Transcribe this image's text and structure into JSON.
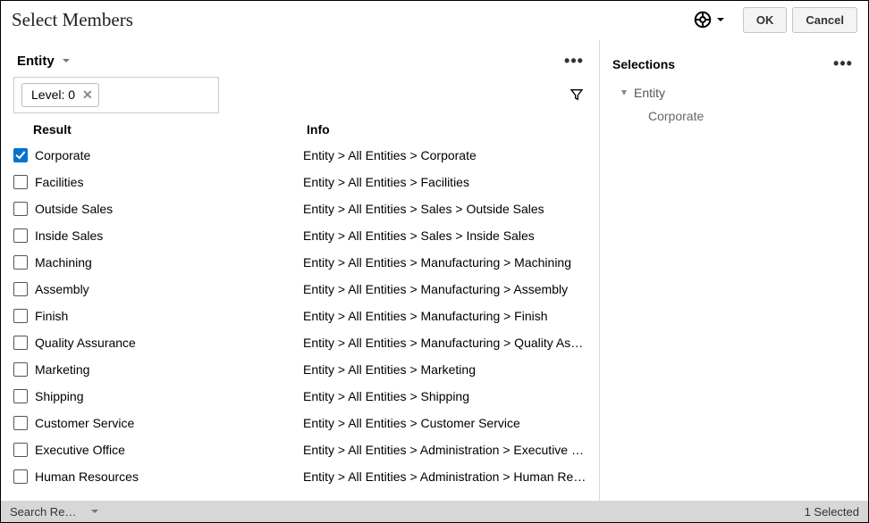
{
  "title": "Select Members",
  "buttons": {
    "ok": "OK",
    "cancel": "Cancel"
  },
  "dimension": {
    "name": "Entity"
  },
  "filter_chip": {
    "label": "Level: 0"
  },
  "columns": {
    "result": "Result",
    "info": "Info"
  },
  "rows": [
    {
      "name": "Corporate",
      "info": "Entity > All Entities > Corporate",
      "checked": true
    },
    {
      "name": "Facilities",
      "info": "Entity > All Entities > Facilities",
      "checked": false
    },
    {
      "name": "Outside Sales",
      "info": "Entity > All Entities > Sales > Outside Sales",
      "checked": false
    },
    {
      "name": "Inside Sales",
      "info": "Entity > All Entities > Sales > Inside Sales",
      "checked": false
    },
    {
      "name": "Machining",
      "info": "Entity > All Entities > Manufacturing > Machining",
      "checked": false
    },
    {
      "name": "Assembly",
      "info": "Entity > All Entities > Manufacturing > Assembly",
      "checked": false
    },
    {
      "name": "Finish",
      "info": "Entity > All Entities > Manufacturing > Finish",
      "checked": false
    },
    {
      "name": "Quality Assurance",
      "info": "Entity > All Entities > Manufacturing > Quality Ass…",
      "checked": false
    },
    {
      "name": "Marketing",
      "info": "Entity > All Entities > Marketing",
      "checked": false
    },
    {
      "name": "Shipping",
      "info": "Entity > All Entities > Shipping",
      "checked": false
    },
    {
      "name": "Customer Service",
      "info": "Entity > All Entities > Customer Service",
      "checked": false
    },
    {
      "name": "Executive Office",
      "info": "Entity > All Entities > Administration > Executive O…",
      "checked": false
    },
    {
      "name": "Human Resources",
      "info": "Entity > All Entities > Administration > Human Res…",
      "checked": false
    }
  ],
  "selections": {
    "heading": "Selections",
    "root": "Entity",
    "items": [
      "Corporate"
    ]
  },
  "footer": {
    "tab": "Search Res…",
    "count": "1 Selected"
  }
}
